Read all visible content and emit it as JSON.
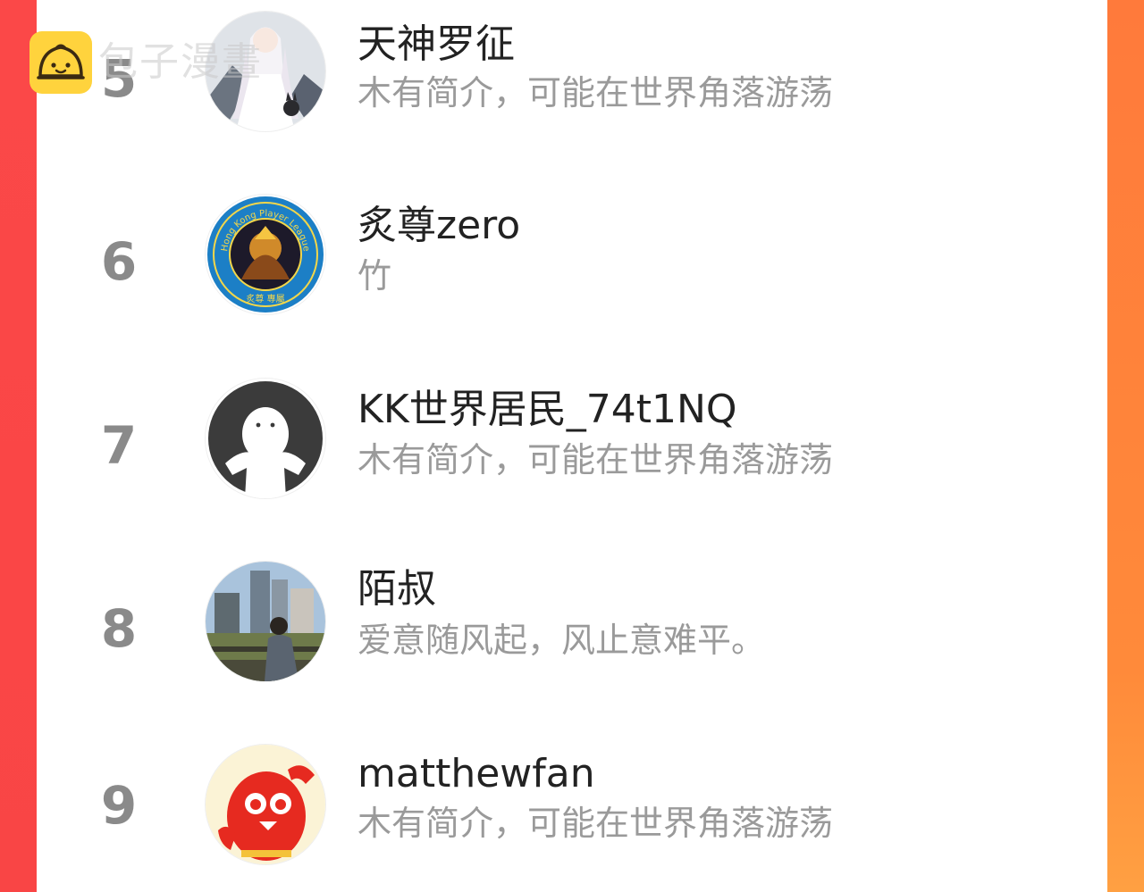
{
  "watermark": {
    "text": "包子漫畫",
    "logo_icon": "bun-icon"
  },
  "ranking": [
    {
      "rank": "5",
      "name": "天神罗征",
      "bio": "木有简介，可能在世界角落游荡",
      "avatar": "anime-girl-avatar"
    },
    {
      "rank": "6",
      "name": "炙尊zero",
      "bio": "竹",
      "avatar": "league-badge-avatar"
    },
    {
      "rank": "7",
      "name": "KK世界居民_74t1NQ",
      "bio": "木有简介，可能在世界角落游荡",
      "avatar": "default-user-avatar"
    },
    {
      "rank": "8",
      "name": "陌叔",
      "bio": "爱意随风起，风止意难平。",
      "avatar": "city-photo-avatar"
    },
    {
      "rank": "9",
      "name": "matthewfan",
      "bio": "木有简介，可能在世界角落游荡",
      "avatar": "red-mascot-avatar"
    }
  ],
  "badge_text": {
    "top": "Hong Kong Player League",
    "bottom": "炙尊 專屬"
  },
  "colors": {
    "accent_left": "#fb4848",
    "accent_right": "#ff8a3a",
    "rank_gray": "#8a8a8a",
    "bio_gray": "#9a9a9a"
  }
}
